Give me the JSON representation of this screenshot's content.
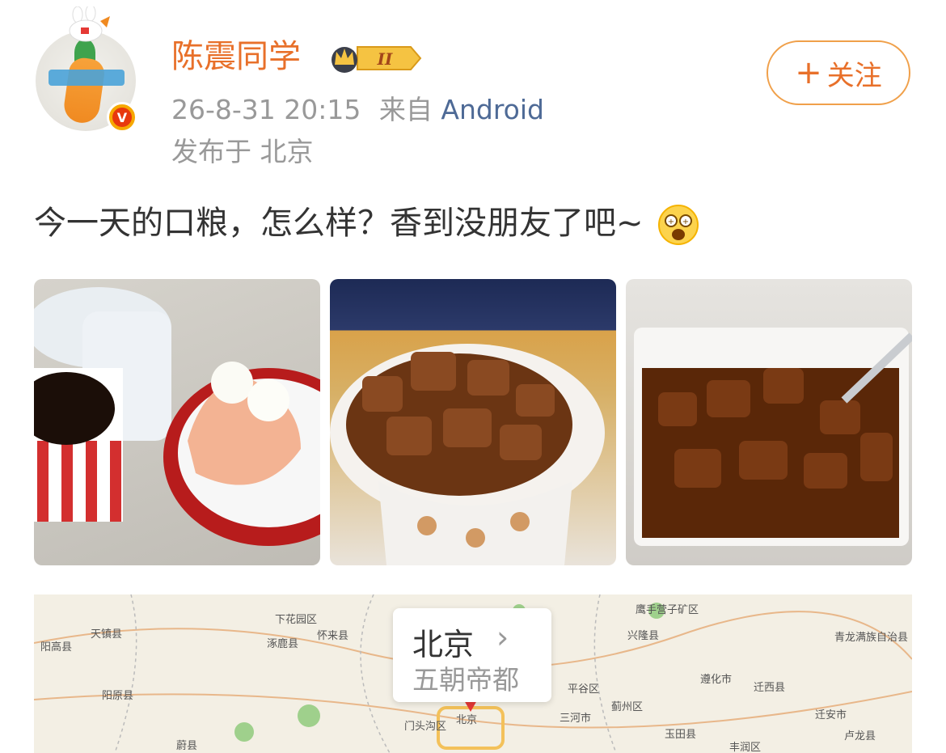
{
  "user": {
    "name": "陈震同学",
    "level_badge": "II",
    "verified_mark": "V"
  },
  "post": {
    "date": "26-8-31 20:15",
    "from_label": "来自",
    "source": "Android",
    "location_line": "发布于 北京",
    "text": "今一天的口粮，怎么样？香到没朋友了吧~"
  },
  "follow_button": {
    "plus": "+",
    "label": "关注"
  },
  "map": {
    "city": "北京",
    "description": "五朝帝都",
    "labels": [
      "天镇县",
      "阳高县",
      "下花园区",
      "怀来县",
      "涿鹿县",
      "阳原县",
      "门头沟区",
      "北京",
      "三河市",
      "平谷区",
      "蓟州区",
      "兴隆县",
      "鹰手营子矿区",
      "青龙满族自治县",
      "遵化市",
      "迁西县",
      "迁安市",
      "卢龙县",
      "玉田县",
      "丰润区",
      "蔚县"
    ]
  },
  "icons": [
    "crown-icon",
    "chevron-right-icon",
    "map-pin-icon",
    "emoji-icon"
  ],
  "colors": {
    "accent": "#e8702a",
    "link": "#4e6a96",
    "muted": "#999999"
  }
}
